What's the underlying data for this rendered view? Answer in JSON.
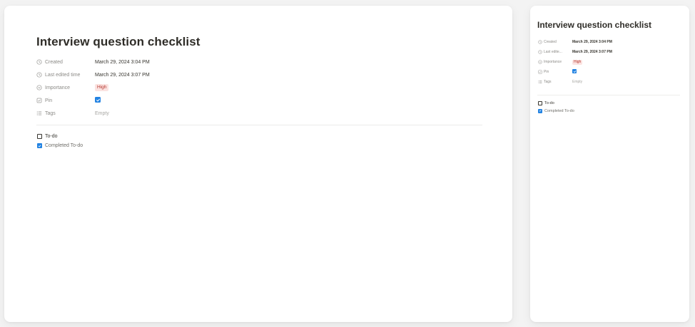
{
  "page": {
    "title": "Interview question checklist"
  },
  "properties": {
    "created": {
      "label": "Created",
      "value": "March 29, 2024 3:04 PM",
      "icon": "clock-icon"
    },
    "last_edited": {
      "label": "Last edited time",
      "label_short": "Last edite...",
      "value": "March 29, 2024 3:07 PM",
      "icon": "clock-icon"
    },
    "importance": {
      "label": "Importance",
      "value": "High",
      "icon": "select-circle-icon",
      "badge_bg": "#fbe3e1",
      "badge_fg": "#b4342b"
    },
    "pin": {
      "label": "Pin",
      "checked": true,
      "icon": "checkbox-icon"
    },
    "tags": {
      "label": "Tags",
      "value": "Empty",
      "icon": "list-icon"
    }
  },
  "todos": [
    {
      "label": "To-do",
      "checked": false
    },
    {
      "label": "Completed To-do",
      "checked": true
    }
  ],
  "colors": {
    "accent": "#2383e2",
    "text": "#37352f",
    "muted": "#8b8a86",
    "background": "#f3f3f3"
  }
}
